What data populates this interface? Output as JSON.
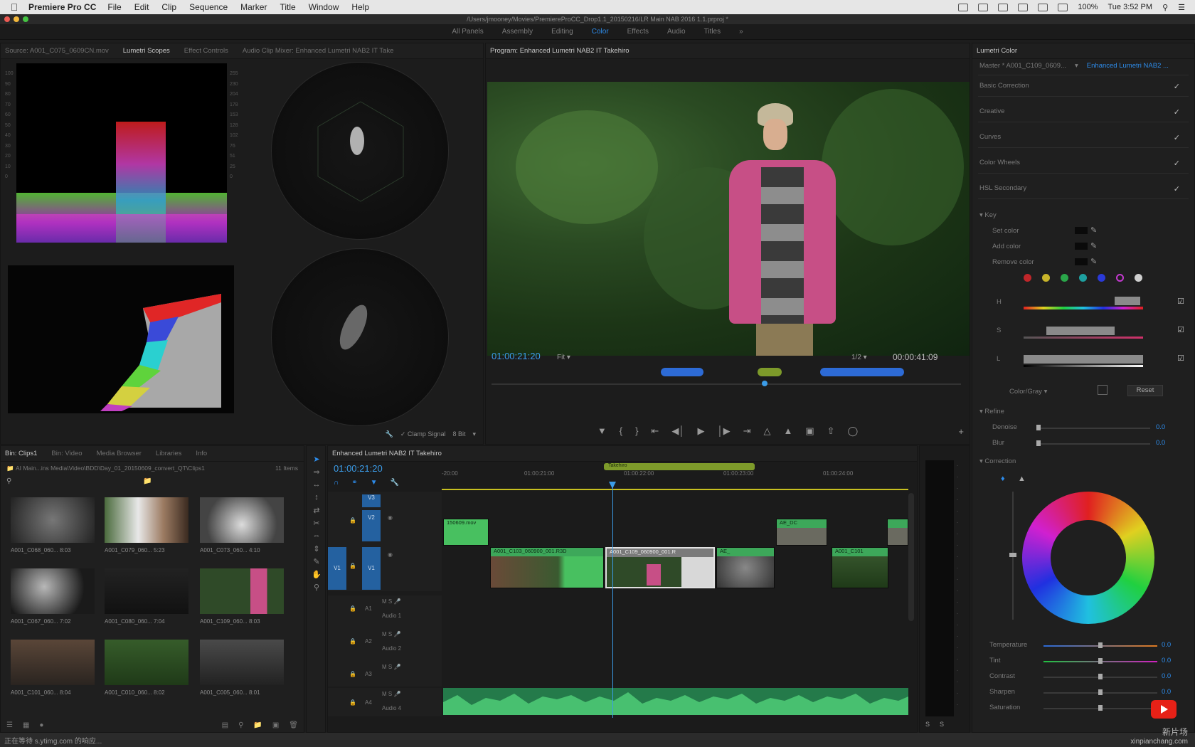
{
  "menubar": {
    "app_name": "Premiere Pro CC",
    "menus": [
      "File",
      "Edit",
      "Clip",
      "Sequence",
      "Marker",
      "Title",
      "Window",
      "Help"
    ],
    "battery": "100%",
    "clock": "Tue 3:52 PM"
  },
  "titlebar": {
    "path": "/Users/jmooney/Movies/PremiereProCC_Drop1.1_20150216/LR Main NAB 2016 1.1.prproj *"
  },
  "workspaces": {
    "items": [
      "All Panels",
      "Assembly",
      "Editing",
      "Color",
      "Effects",
      "Audio",
      "Titles"
    ],
    "active": "Color"
  },
  "scopes": {
    "tabs": [
      "Source: A001_C075_0609CN.mov",
      "Lumetri Scopes",
      "Effect Controls",
      "Audio Clip Mixer: Enhanced Lumetri NAB2 IT Take"
    ],
    "active_tab": "Lumetri Scopes",
    "scale_left": [
      "100",
      "90",
      "80",
      "70",
      "60",
      "50",
      "40",
      "30",
      "20",
      "10",
      "0"
    ],
    "scale_right": [
      "255",
      "230",
      "204",
      "178",
      "153",
      "128",
      "102",
      "76",
      "51",
      "25",
      "0"
    ],
    "footer": {
      "clamp": "Clamp Signal",
      "bits": "8 Bit"
    }
  },
  "program": {
    "title": "Program: Enhanced Lumetri NAB2 IT Takehiro",
    "timecode_in": "01:00:21:20",
    "fit": "Fit",
    "resolution": "1/2",
    "duration": "00:00:41:09"
  },
  "lumetri": {
    "title": "Lumetri Color",
    "clip": "Master * A001_C109_0609...",
    "clip2": "Enhanced Lumetri NAB2 ...",
    "sections": [
      "Basic Correction",
      "Creative",
      "Curves",
      "Color Wheels",
      "HSL Secondary"
    ],
    "key": {
      "label": "Key",
      "set": "Set color",
      "add": "Add color",
      "remove": "Remove color"
    },
    "hsl_labels": [
      "H",
      "S",
      "L"
    ],
    "color_gray": "Color/Gray",
    "reset": "Reset",
    "refine": {
      "label": "Refine",
      "denoise": "Denoise",
      "blur": "Blur",
      "denoise_val": "0.0",
      "blur_val": "0.0"
    },
    "correction": {
      "label": "Correction",
      "sliders": [
        {
          "name": "Temperature",
          "value": "0.0"
        },
        {
          "name": "Tint",
          "value": "0.0"
        },
        {
          "name": "Contrast",
          "value": "0.0"
        },
        {
          "name": "Sharpen",
          "value": "0.0"
        },
        {
          "name": "Saturation",
          "value": "0.0"
        }
      ]
    }
  },
  "project": {
    "tabs": [
      "Bin: Clips1",
      "Bin: Video",
      "Media Browser",
      "Libraries",
      "Info"
    ],
    "active_tab": "Bin: Clips1",
    "path": "AI Main...ins Media\\Video\\BDD\\Day_01_20150609_convert_QT\\Clips1",
    "count": "11 Items",
    "thumbs": [
      {
        "name": "A001_C068_060...",
        "dur": "8:03"
      },
      {
        "name": "A001_C079_060...",
        "dur": "5:23"
      },
      {
        "name": "A001_C073_060...",
        "dur": "4:10"
      },
      {
        "name": "A001_C067_060...",
        "dur": "7:02"
      },
      {
        "name": "A001_C080_060...",
        "dur": "7:04"
      },
      {
        "name": "A001_C109_060...",
        "dur": "8:03"
      },
      {
        "name": "A001_C101_060...",
        "dur": "8:04"
      },
      {
        "name": "A001_C010_060...",
        "dur": "8:02"
      },
      {
        "name": "A001_C005_060...",
        "dur": "8:01"
      }
    ]
  },
  "timeline": {
    "title": "Enhanced Lumetri NAB2 IT Takehiro",
    "timecode": "01:00:21:20",
    "ruler": [
      "-20:00",
      "01:00:21:00",
      "01:00:22:00",
      "01:00:23:00",
      "01:00:24:00"
    ],
    "work_area": "Takehiro",
    "tracks": {
      "v3": "V3",
      "v2": "V2",
      "v1": "V1",
      "v1_src": "V1",
      "a1": "A1",
      "a1_name": "Audio 1",
      "a2": "A2",
      "a2_name": "Audio 2",
      "a3": "A3",
      "a4": "A4",
      "a4_name": "Audio 4"
    },
    "clips": {
      "v2_a": "150609.mov",
      "v2_b": "AE_DC",
      "v1_a": "A001_C103_060900_001.R3D",
      "v1_b": "A001_C109_060900_001.R",
      "v1_c": "AE_",
      "v1_d": "A001_C101"
    }
  },
  "status": {
    "text": "正在等待 s.ytimg.com 的响应...",
    "watermark": "新片场",
    "watermark2": "xinpianchang.com"
  },
  "colors": {
    "accent": "#2d8ceb",
    "clip_green": "#3da85a",
    "audio_green": "#2e9a5d"
  }
}
